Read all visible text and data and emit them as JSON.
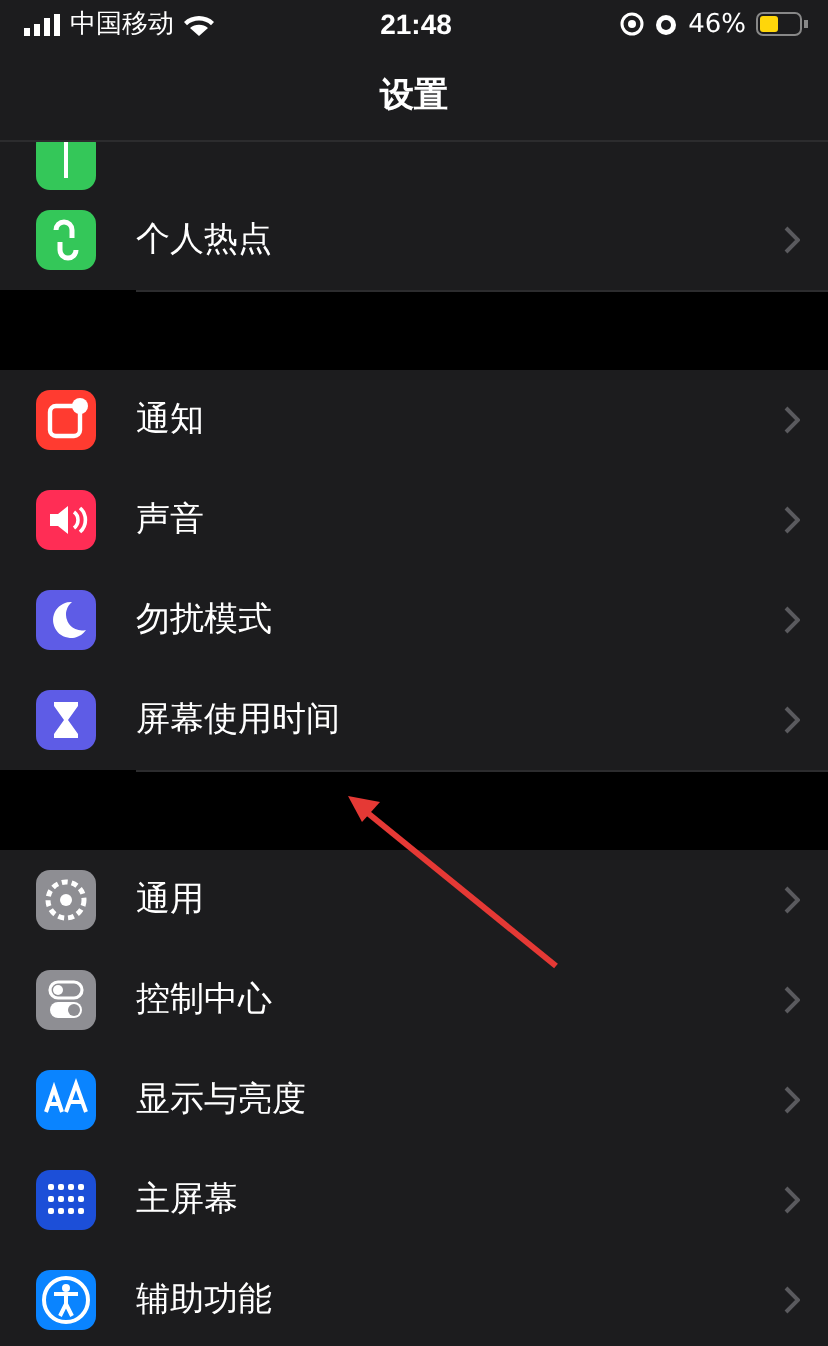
{
  "status_bar": {
    "carrier": "中国移动",
    "time": "21:48",
    "battery": "46%"
  },
  "nav": {
    "title": "设置"
  },
  "sections": [
    {
      "items": [
        {
          "kind": "cellular",
          "color": "#34c759"
        },
        {
          "kind": "hotspot",
          "color": "#34c759",
          "label": "个人热点"
        }
      ]
    },
    {
      "items": [
        {
          "kind": "notifications",
          "color": "#ff3b30",
          "label": "通知"
        },
        {
          "kind": "sounds",
          "color": "#ff2d55",
          "label": "声音"
        },
        {
          "kind": "moon",
          "color": "#5e5ce6",
          "label": "勿扰模式"
        },
        {
          "kind": "hourglass",
          "color": "#5e5ce6",
          "label": "屏幕使用时间"
        }
      ]
    },
    {
      "items": [
        {
          "kind": "gear",
          "color": "#8e8e93",
          "label": "通用"
        },
        {
          "kind": "toggles",
          "color": "#8e8e93",
          "label": "控制中心"
        },
        {
          "kind": "text-size",
          "color": "#0a84ff",
          "label": "显示与亮度"
        },
        {
          "kind": "grid",
          "color": "#1c4fd8",
          "label": "主屏幕"
        },
        {
          "kind": "accessibility",
          "color": "#0a84ff",
          "label": "辅助功能"
        }
      ]
    }
  ]
}
